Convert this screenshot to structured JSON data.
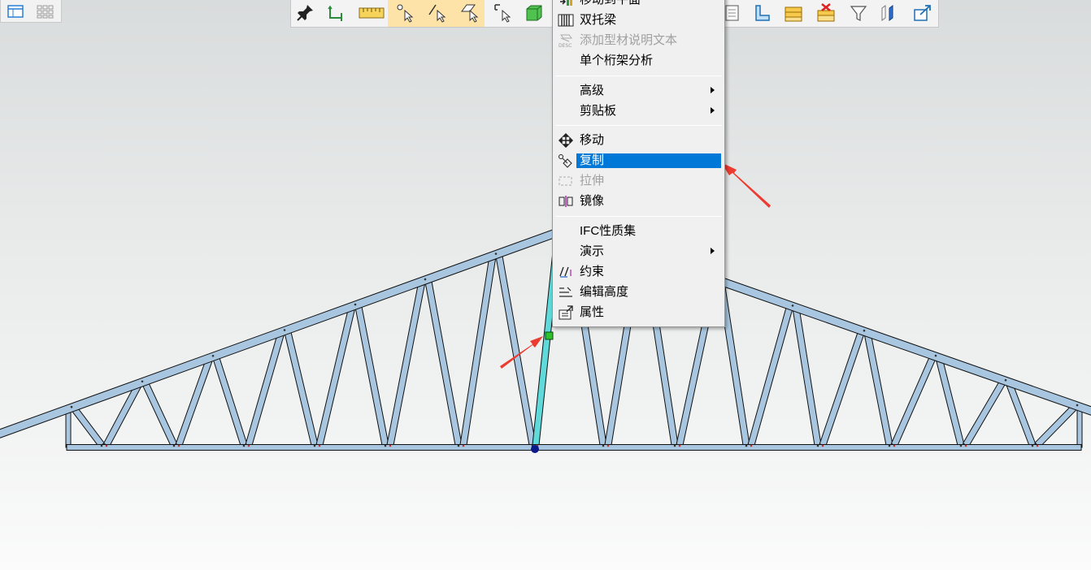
{
  "menu": {
    "items": [
      {
        "id": "move-to-plane",
        "label": "移动到平面",
        "icon": "move-to-plane-icon",
        "disabled": false,
        "submenu": false
      },
      {
        "id": "double-truss",
        "label": "双托梁",
        "icon": "double-truss-icon",
        "disabled": false,
        "submenu": false
      },
      {
        "id": "add-description",
        "label": "添加型材说明文本",
        "icon": "description-icon",
        "disabled": true,
        "submenu": false
      },
      {
        "id": "single-truss-analysis",
        "label": "单个桁架分析",
        "icon": "",
        "disabled": false,
        "submenu": false
      },
      {
        "id": "advanced",
        "label": "高级",
        "icon": "",
        "disabled": false,
        "submenu": true
      },
      {
        "id": "clipboard",
        "label": "剪贴板",
        "icon": "",
        "disabled": false,
        "submenu": true
      },
      {
        "id": "move",
        "label": "移动",
        "icon": "move-icon",
        "disabled": false,
        "submenu": false
      },
      {
        "id": "copy",
        "label": "复制",
        "icon": "copy-icon",
        "disabled": false,
        "submenu": false,
        "highlighted": true
      },
      {
        "id": "stretch",
        "label": "拉伸",
        "icon": "stretch-icon",
        "disabled": true,
        "submenu": false
      },
      {
        "id": "mirror",
        "label": "镜像",
        "icon": "mirror-icon",
        "disabled": false,
        "submenu": false
      },
      {
        "id": "ifc-properties",
        "label": "IFC性质集",
        "icon": "",
        "disabled": false,
        "submenu": false
      },
      {
        "id": "demo",
        "label": "演示",
        "icon": "",
        "disabled": false,
        "submenu": true
      },
      {
        "id": "constraint",
        "label": "约束",
        "icon": "constraint-icon",
        "disabled": false,
        "submenu": false
      },
      {
        "id": "edit-height",
        "label": "编辑高度",
        "icon": "edit-height-icon",
        "disabled": false,
        "submenu": false
      },
      {
        "id": "properties",
        "label": "属性",
        "icon": "properties-icon",
        "disabled": false,
        "submenu": false
      }
    ]
  },
  "toolbar": {
    "left_icons": [
      "pin-icon",
      "snap-icon",
      "measure-icon",
      "select-point-icon",
      "select-edge-icon",
      "select-face-icon",
      "select-component-icon",
      "solid-view-icon"
    ],
    "right_icons": [
      "list-icon",
      "profile-icon",
      "layers-icon",
      "delete-layers-icon",
      "filter-icon",
      "section-icon",
      "export-icon"
    ],
    "highlight_color": "#fde3a7"
  },
  "mini_toolbar": {
    "icons": [
      "window-layout-icon",
      "grid-layout-icon"
    ]
  },
  "colors": {
    "member_fill": "#a9c6e0",
    "member_outline": "#111111",
    "selected_member": "#5fd9d9",
    "annotation_arrow": "#ec3b30",
    "menu_highlight": "#0078d7"
  }
}
